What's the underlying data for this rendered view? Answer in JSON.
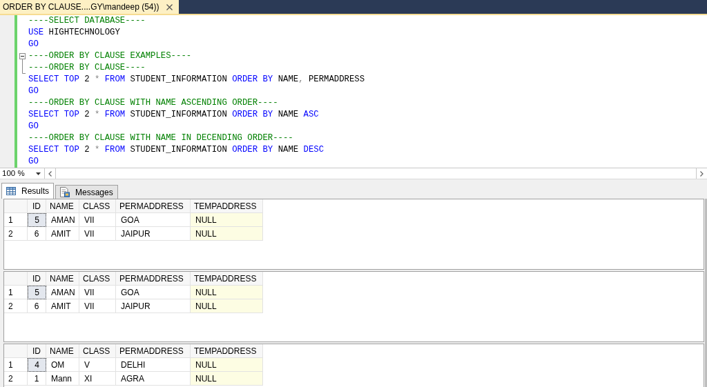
{
  "document_tab": {
    "title": "ORDER BY CLAUSE....GY\\mandeep (54))"
  },
  "editor": {
    "lines": [
      {
        "kind": "code",
        "tokens": [
          {
            "kind": "comment",
            "text": "----SELECT DATABASE----"
          }
        ]
      },
      {
        "kind": "code",
        "tokens": [
          {
            "kind": "keyword",
            "text": "USE"
          },
          {
            "kind": "plain",
            "text": " HIGHTECHNOLOGY"
          }
        ]
      },
      {
        "kind": "code",
        "tokens": [
          {
            "kind": "keyword",
            "text": "GO"
          }
        ]
      },
      {
        "kind": "foldstart",
        "expanded": true,
        "tokens": [
          {
            "kind": "comment",
            "text": "----ORDER BY CLAUSE EXAMPLES----"
          }
        ]
      },
      {
        "kind": "foldend",
        "tokens": [
          {
            "kind": "comment",
            "text": "----ORDER BY CLAUSE----"
          }
        ]
      },
      {
        "kind": "code",
        "tokens": [
          {
            "kind": "keyword",
            "text": "SELECT TOP"
          },
          {
            "kind": "plain",
            "text": " 2 "
          },
          {
            "kind": "operator",
            "text": "*"
          },
          {
            "kind": "keyword",
            "text": " FROM"
          },
          {
            "kind": "plain",
            "text": " STUDENT_INFORMATION "
          },
          {
            "kind": "keyword",
            "text": "ORDER BY"
          },
          {
            "kind": "plain",
            "text": " NAME"
          },
          {
            "kind": "operator",
            "text": ","
          },
          {
            "kind": "plain",
            "text": " PERMADDRESS"
          }
        ]
      },
      {
        "kind": "code",
        "tokens": [
          {
            "kind": "keyword",
            "text": "GO"
          }
        ]
      },
      {
        "kind": "code",
        "tokens": [
          {
            "kind": "comment",
            "text": "----ORDER BY CLAUSE WITH NAME ASCENDING ORDER----"
          }
        ]
      },
      {
        "kind": "code",
        "tokens": [
          {
            "kind": "keyword",
            "text": "SELECT TOP"
          },
          {
            "kind": "plain",
            "text": " 2 "
          },
          {
            "kind": "operator",
            "text": "*"
          },
          {
            "kind": "keyword",
            "text": " FROM"
          },
          {
            "kind": "plain",
            "text": " STUDENT_INFORMATION "
          },
          {
            "kind": "keyword",
            "text": "ORDER BY"
          },
          {
            "kind": "plain",
            "text": " NAME "
          },
          {
            "kind": "keyword",
            "text": "ASC"
          }
        ]
      },
      {
        "kind": "code",
        "tokens": [
          {
            "kind": "keyword",
            "text": "GO"
          }
        ]
      },
      {
        "kind": "code",
        "tokens": [
          {
            "kind": "comment",
            "text": "----ORDER BY CLAUSE WITH NAME IN DECENDING ORDER----"
          }
        ]
      },
      {
        "kind": "code",
        "tokens": [
          {
            "kind": "keyword",
            "text": "SELECT TOP"
          },
          {
            "kind": "plain",
            "text": " 2 "
          },
          {
            "kind": "operator",
            "text": "*"
          },
          {
            "kind": "keyword",
            "text": " FROM"
          },
          {
            "kind": "plain",
            "text": " STUDENT_INFORMATION "
          },
          {
            "kind": "keyword",
            "text": "ORDER BY"
          },
          {
            "kind": "plain",
            "text": " NAME "
          },
          {
            "kind": "keyword",
            "text": "DESC"
          }
        ]
      },
      {
        "kind": "code",
        "tokens": [
          {
            "kind": "keyword",
            "text": "GO"
          }
        ]
      }
    ]
  },
  "zoom_bar": {
    "zoom": "100 %"
  },
  "result_tabs": [
    {
      "kind": "grid",
      "label": "Results",
      "selected": true
    },
    {
      "kind": "messages",
      "label": "Messages",
      "selected": false
    }
  ],
  "result_sets": [
    {
      "columns": [
        "ID",
        "NAME",
        "CLASS",
        "PERMADDRESS",
        "TEMPADDRESS"
      ],
      "rows": [
        {
          "number": "1",
          "cells": [
            {
              "text": "5",
              "focused": true,
              "is_null": false
            },
            {
              "text": "AMAN",
              "focused": false,
              "is_null": false
            },
            {
              "text": "VII",
              "focused": false,
              "is_null": false
            },
            {
              "text": "GOA",
              "focused": false,
              "is_null": false
            },
            {
              "text": "NULL",
              "focused": false,
              "is_null": true
            }
          ]
        },
        {
          "number": "2",
          "cells": [
            {
              "text": "6",
              "focused": false,
              "is_null": false
            },
            {
              "text": "AMIT",
              "focused": false,
              "is_null": false
            },
            {
              "text": "VII",
              "focused": false,
              "is_null": false
            },
            {
              "text": "JAIPUR",
              "focused": false,
              "is_null": false
            },
            {
              "text": "NULL",
              "focused": false,
              "is_null": true
            }
          ]
        }
      ]
    },
    {
      "columns": [
        "ID",
        "NAME",
        "CLASS",
        "PERMADDRESS",
        "TEMPADDRESS"
      ],
      "rows": [
        {
          "number": "1",
          "cells": [
            {
              "text": "5",
              "focused": true,
              "is_null": false
            },
            {
              "text": "AMAN",
              "focused": false,
              "is_null": false
            },
            {
              "text": "VII",
              "focused": false,
              "is_null": false
            },
            {
              "text": "GOA",
              "focused": false,
              "is_null": false
            },
            {
              "text": "NULL",
              "focused": false,
              "is_null": true
            }
          ]
        },
        {
          "number": "2",
          "cells": [
            {
              "text": "6",
              "focused": false,
              "is_null": false
            },
            {
              "text": "AMIT",
              "focused": false,
              "is_null": false
            },
            {
              "text": "VII",
              "focused": false,
              "is_null": false
            },
            {
              "text": "JAIPUR",
              "focused": false,
              "is_null": false
            },
            {
              "text": "NULL",
              "focused": false,
              "is_null": true
            }
          ]
        }
      ]
    },
    {
      "columns": [
        "ID",
        "NAME",
        "CLASS",
        "PERMADDRESS",
        "TEMPADDRESS"
      ],
      "rows": [
        {
          "number": "1",
          "cells": [
            {
              "text": "4",
              "focused": true,
              "is_null": false
            },
            {
              "text": "OM",
              "focused": false,
              "is_null": false
            },
            {
              "text": "V",
              "focused": false,
              "is_null": false
            },
            {
              "text": "DELHI",
              "focused": false,
              "is_null": false
            },
            {
              "text": "NULL",
              "focused": false,
              "is_null": true
            }
          ]
        },
        {
          "number": "2",
          "cells": [
            {
              "text": "1",
              "focused": false,
              "is_null": false
            },
            {
              "text": "Mann",
              "focused": false,
              "is_null": false
            },
            {
              "text": "XI",
              "focused": false,
              "is_null": false
            },
            {
              "text": "AGRA",
              "focused": false,
              "is_null": false
            },
            {
              "text": "NULL",
              "focused": false,
              "is_null": true
            }
          ]
        }
      ]
    }
  ]
}
